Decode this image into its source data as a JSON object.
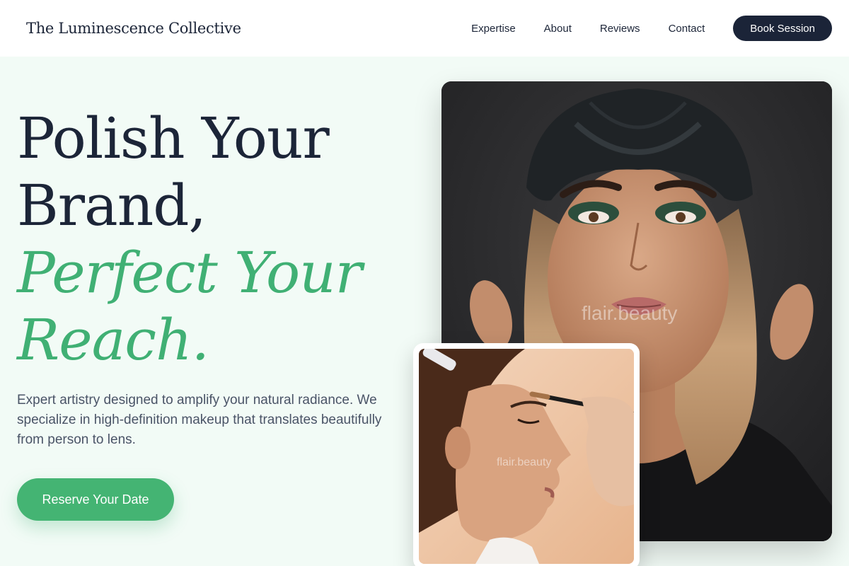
{
  "brand": {
    "name": "The Luminescence Collective"
  },
  "nav": {
    "items": [
      {
        "label": "Expertise"
      },
      {
        "label": "About"
      },
      {
        "label": "Reviews"
      },
      {
        "label": "Contact"
      }
    ],
    "cta_label": "Book Session"
  },
  "hero": {
    "title_line1": "Polish Your",
    "title_line2": "Brand,",
    "accent_line1": "Perfect Your",
    "accent_line2": "Reach.",
    "description": "Expert artistry designed to amplify your natural radiance. We specialize in high-definition makeup that translates beautifully from person to lens.",
    "cta_label": "Reserve Your Date"
  },
  "images": {
    "main_watermark": "flair.beauty",
    "inset_watermark": "flair.beauty"
  },
  "colors": {
    "accent": "#40b074",
    "dark": "#1b2438",
    "background": "#f2fbf6"
  }
}
